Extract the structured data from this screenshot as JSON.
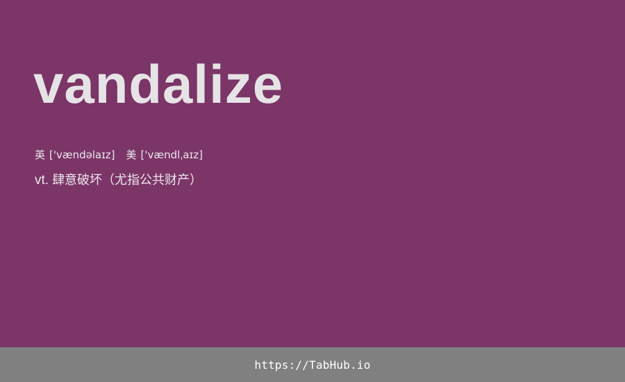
{
  "colors": {
    "background": "#7b3567",
    "word": "#e6e3e6",
    "text": "#ece7ec",
    "footer_background": "#808080",
    "footer_text": "#ffffff"
  },
  "entry": {
    "word": "vandalize",
    "phonetics": [
      {
        "label": "英",
        "ipa": "['vændəlaɪz]"
      },
      {
        "label": "美",
        "ipa": "['vændlˌaɪz]"
      }
    ],
    "definition": {
      "pos": "vt.",
      "meaning": "肆意破坏（尤指公共财产）"
    }
  },
  "footer": {
    "link_text": "https://TabHub.io"
  }
}
